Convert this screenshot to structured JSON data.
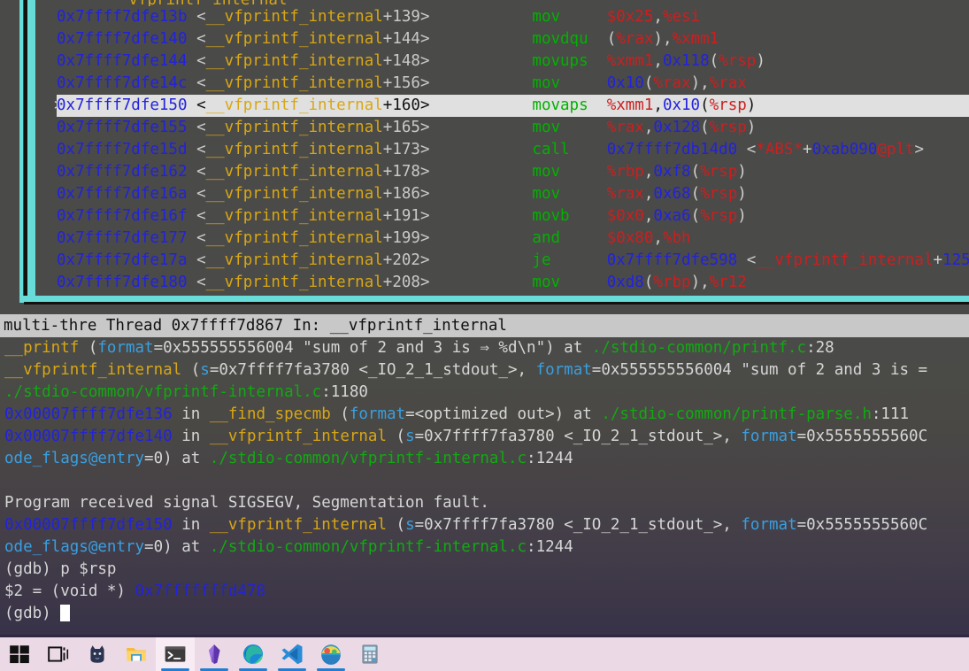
{
  "assembly": {
    "partial_top_line": "__vfprintf_internal",
    "rows": [
      {
        "marker": "",
        "addr": "0x7ffff7dfe13b",
        "sym": "__vfprintf_internal",
        "offset": "+139",
        "mnem": "mov",
        "ops": "$0x25,%esi",
        "current": false
      },
      {
        "marker": "",
        "addr": "0x7ffff7dfe140",
        "sym": "__vfprintf_internal",
        "offset": "+144",
        "mnem": "movdqu",
        "ops": "(%rax),%xmm1",
        "current": false
      },
      {
        "marker": "",
        "addr": "0x7ffff7dfe144",
        "sym": "__vfprintf_internal",
        "offset": "+148",
        "mnem": "movups",
        "ops": "%xmm1,0x118(%rsp)",
        "current": false
      },
      {
        "marker": "",
        "addr": "0x7ffff7dfe14c",
        "sym": "__vfprintf_internal",
        "offset": "+156",
        "mnem": "mov",
        "ops": "0x10(%rax),%rax",
        "current": false
      },
      {
        "marker": ">",
        "addr": "0x7ffff7dfe150",
        "sym": "__vfprintf_internal",
        "offset": "+160",
        "mnem": "movaps",
        "ops": "%xmm1,0x10(%rsp)",
        "current": true
      },
      {
        "marker": "",
        "addr": "0x7ffff7dfe155",
        "sym": "__vfprintf_internal",
        "offset": "+165",
        "mnem": "mov",
        "ops": "%rax,0x128(%rsp)",
        "current": false
      },
      {
        "marker": "",
        "addr": "0x7ffff7dfe15d",
        "sym": "__vfprintf_internal",
        "offset": "+173",
        "mnem": "call",
        "ops": "0x7ffff7db14d0 <*ABS*+0xab090@plt>",
        "current": false
      },
      {
        "marker": "",
        "addr": "0x7ffff7dfe162",
        "sym": "__vfprintf_internal",
        "offset": "+178",
        "mnem": "mov",
        "ops": "%rbp,0xf8(%rsp)",
        "current": false
      },
      {
        "marker": "",
        "addr": "0x7ffff7dfe16a",
        "sym": "__vfprintf_internal",
        "offset": "+186",
        "mnem": "mov",
        "ops": "%rax,0x68(%rsp)",
        "current": false
      },
      {
        "marker": "",
        "addr": "0x7ffff7dfe16f",
        "sym": "__vfprintf_internal",
        "offset": "+191",
        "mnem": "movb",
        "ops": "$0x0,0xa6(%rsp)",
        "current": false
      },
      {
        "marker": "",
        "addr": "0x7ffff7dfe177",
        "sym": "__vfprintf_internal",
        "offset": "+199",
        "mnem": "and",
        "ops": "$0x80,%bh",
        "current": false
      },
      {
        "marker": "",
        "addr": "0x7ffff7dfe17a",
        "sym": "__vfprintf_internal",
        "offset": "+202",
        "mnem": "je",
        "ops": "0x7ffff7dfe598 <__vfprintf_internal+125",
        "current": false
      },
      {
        "marker": "",
        "addr": "0x7ffff7dfe180",
        "sym": "__vfprintf_internal",
        "offset": "+208",
        "mnem": "mov",
        "ops": "0xd8(%rbp),%r12",
        "current": false
      }
    ]
  },
  "status_bar": {
    "text": "multi-thre Thread 0x7ffff7d867 In: __vfprintf_internal"
  },
  "command_window": {
    "lines": [
      {
        "segments": [
          {
            "t": "__printf ",
            "c": "c-yellow"
          },
          {
            "t": "(",
            "c": "c-white"
          },
          {
            "t": "format",
            "c": "c-cyan"
          },
          {
            "t": "=0x555555556004 \"sum of 2 and 3 is ⇒ %d\\n\") at ",
            "c": "c-white"
          },
          {
            "t": "./stdio-common/printf.c",
            "c": "c-green"
          },
          {
            "t": ":28",
            "c": "c-white"
          }
        ]
      },
      {
        "segments": [
          {
            "t": "__vfprintf_internal ",
            "c": "c-yellow"
          },
          {
            "t": "(",
            "c": "c-white"
          },
          {
            "t": "s",
            "c": "c-cyan"
          },
          {
            "t": "=0x7ffff7fa3780 <_IO_2_1_stdout_>, ",
            "c": "c-white"
          },
          {
            "t": "format",
            "c": "c-cyan"
          },
          {
            "t": "=0x555555556004 \"sum of 2 and 3 is =",
            "c": "c-white"
          }
        ]
      },
      {
        "segments": [
          {
            "t": "./stdio-common/vfprintf-internal.c",
            "c": "c-green"
          },
          {
            "t": ":1180",
            "c": "c-white"
          }
        ]
      },
      {
        "segments": [
          {
            "t": "0x00007ffff7dfe136",
            "c": "c-blue"
          },
          {
            "t": " in ",
            "c": "c-white"
          },
          {
            "t": "__find_specmb",
            "c": "c-yellow"
          },
          {
            "t": " (",
            "c": "c-white"
          },
          {
            "t": "format",
            "c": "c-cyan"
          },
          {
            "t": "=<optimized out>) at ",
            "c": "c-white"
          },
          {
            "t": "./stdio-common/printf-parse.h",
            "c": "c-green"
          },
          {
            "t": ":111",
            "c": "c-white"
          }
        ]
      },
      {
        "segments": [
          {
            "t": "0x00007ffff7dfe140",
            "c": "c-blue"
          },
          {
            "t": " in ",
            "c": "c-white"
          },
          {
            "t": "__vfprintf_internal",
            "c": "c-yellow"
          },
          {
            "t": " (",
            "c": "c-white"
          },
          {
            "t": "s",
            "c": "c-cyan"
          },
          {
            "t": "=0x7ffff7fa3780 <_IO_2_1_stdout_>, ",
            "c": "c-white"
          },
          {
            "t": "format",
            "c": "c-cyan"
          },
          {
            "t": "=0x5555555560C",
            "c": "c-white"
          }
        ]
      },
      {
        "segments": [
          {
            "t": "ode_flags@entry",
            "c": "c-cyan"
          },
          {
            "t": "=0) at ",
            "c": "c-white"
          },
          {
            "t": "./stdio-common/vfprintf-internal.c",
            "c": "c-green"
          },
          {
            "t": ":1244",
            "c": "c-white"
          }
        ]
      },
      {
        "segments": []
      },
      {
        "segments": [
          {
            "t": "Program received signal SIGSEGV, Segmentation fault.",
            "c": "c-white"
          }
        ]
      },
      {
        "segments": [
          {
            "t": "0x00007ffff7dfe150",
            "c": "c-blue"
          },
          {
            "t": " in ",
            "c": "c-white"
          },
          {
            "t": "__vfprintf_internal",
            "c": "c-yellow"
          },
          {
            "t": " (",
            "c": "c-white"
          },
          {
            "t": "s",
            "c": "c-cyan"
          },
          {
            "t": "=0x7ffff7fa3780 <_IO_2_1_stdout_>, ",
            "c": "c-white"
          },
          {
            "t": "format",
            "c": "c-cyan"
          },
          {
            "t": "=0x5555555560C",
            "c": "c-white"
          }
        ]
      },
      {
        "segments": [
          {
            "t": "ode_flags@entry",
            "c": "c-cyan"
          },
          {
            "t": "=0) at ",
            "c": "c-white"
          },
          {
            "t": "./stdio-common/vfprintf-internal.c",
            "c": "c-green"
          },
          {
            "t": ":1244",
            "c": "c-white"
          }
        ]
      },
      {
        "segments": [
          {
            "t": "(gdb) p $rsp",
            "c": "c-white"
          }
        ]
      },
      {
        "segments": [
          {
            "t": "$2 = (void *) ",
            "c": "c-white"
          },
          {
            "t": "0x7fffffffd478",
            "c": "c-blue"
          }
        ]
      },
      {
        "segments": [
          {
            "t": "(gdb) ",
            "c": "c-white"
          },
          {
            "t": "",
            "c": "cursor"
          }
        ]
      }
    ]
  },
  "taskbar": {
    "items": [
      {
        "icon": "windows-start-icon",
        "label": "Start",
        "active": false,
        "running": false
      },
      {
        "icon": "task-view-icon",
        "label": "Task View",
        "active": false,
        "running": false
      },
      {
        "icon": "cat-app-icon",
        "label": "Kitty",
        "active": false,
        "running": false
      },
      {
        "icon": "file-explorer-icon",
        "label": "File Explorer",
        "active": false,
        "running": false
      },
      {
        "icon": "terminal-icon",
        "label": "Terminal",
        "active": true,
        "running": true
      },
      {
        "icon": "purple-gem-icon",
        "label": "Diamond App",
        "active": false,
        "running": true
      },
      {
        "icon": "edge-browser-icon",
        "label": "Microsoft Edge",
        "active": false,
        "running": true
      },
      {
        "icon": "vscode-icon",
        "label": "Visual Studio Code",
        "active": false,
        "running": true
      },
      {
        "icon": "colorful-bowl-icon",
        "label": "Media App",
        "active": false,
        "running": true
      },
      {
        "icon": "calculator-icon",
        "label": "Calculator",
        "active": false,
        "running": false
      }
    ]
  },
  "colors": {
    "border_cyan": "#67dcd8",
    "status_bg": "#c8c8c8",
    "addr_blue": "#2222dd",
    "symbol_yellow": "#d8a715",
    "mnemonic_green": "#00b200",
    "operand_red": "#cc1f1f",
    "path_green": "#11aa11",
    "taskbar_bg": "#ecd9e6"
  }
}
